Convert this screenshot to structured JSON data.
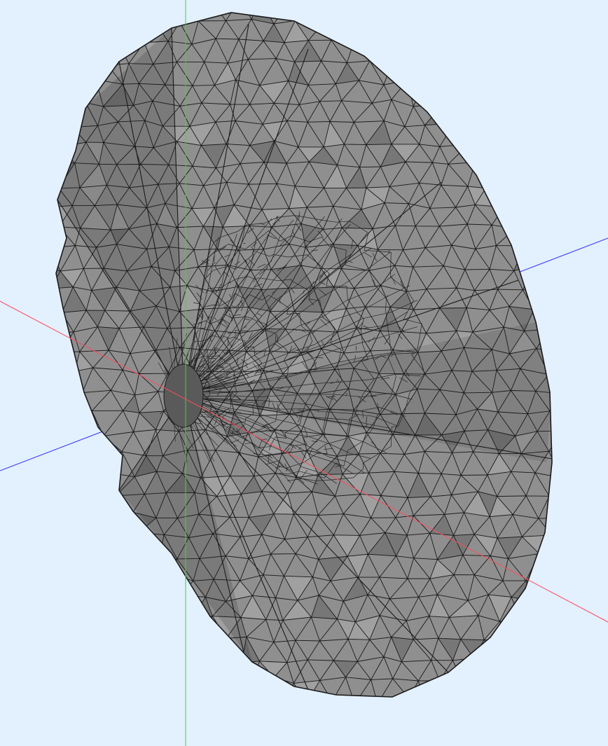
{
  "viewer": {
    "background": "#e3f0fd",
    "mesh_fill": "#8f8f8f",
    "mesh_fill_dark": "#777777",
    "mesh_fill_light": "#a0a0a0",
    "edge_color": "#1a1a1a",
    "axes": {
      "x_color": "#ff4d5e",
      "y_color": "#33dd33",
      "z_color": "#3030ff"
    }
  }
}
